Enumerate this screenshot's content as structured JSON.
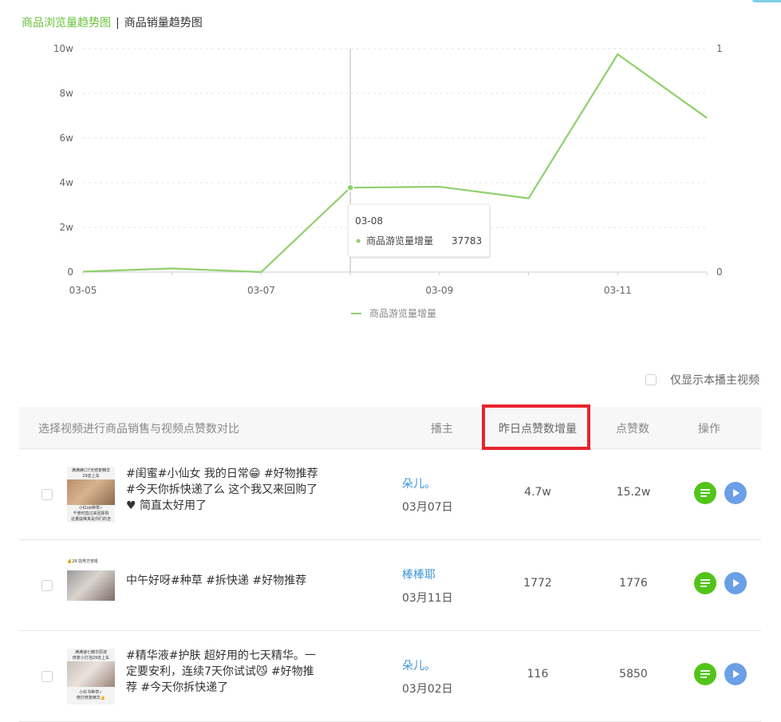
{
  "tabs": {
    "active": "商品浏览量趋势图",
    "separator": "|",
    "other": "商品销量趋势图"
  },
  "chart_data": {
    "type": "line",
    "x": [
      "03-05",
      "03-06",
      "03-07",
      "03-08",
      "03-09",
      "03-10",
      "03-11",
      "03-12"
    ],
    "x_tick_labels": [
      "03-05",
      "03-07",
      "03-09",
      "03-11"
    ],
    "y_tick_labels": [
      "0",
      "2w",
      "4w",
      "6w",
      "8w",
      "10w"
    ],
    "y2_tick_labels": [
      "0",
      "1"
    ],
    "series": [
      {
        "name": "商品游览量增量",
        "values": [
          200,
          1600,
          0,
          37783,
          38200,
          33000,
          97500,
          69000
        ],
        "color": "#8fd06c"
      }
    ],
    "ylim": [
      0,
      100000
    ],
    "y2lim": [
      0,
      1
    ],
    "grid": true,
    "legend_position": "bottom-center",
    "tooltip": {
      "date": "03-08",
      "label": "商品游览量增量",
      "value": "37783"
    }
  },
  "filter": {
    "only_this_label": "仅显示本播主视频"
  },
  "table": {
    "headers": {
      "select": "选择视频进行商品销售与视频点赞数对比",
      "author": "播主",
      "likes_increase": "昨日点赞数增量",
      "likes": "点赞数",
      "actions": "操作"
    },
    "rows": [
      {
        "thumb_caption": [
          "满满蜂口7天修复精华",
          "29去上车"
        ],
        "thumb_caption_bottom": [
          "小红ob种草✓",
          "千修时直过来回挥购",
          "这量提维真是你们的怎"
        ],
        "title": "#闺蜜#小仙女 我的日常😁 #好物推荐 #今天你拆快递了么 这个我又来回购了♥ 简直太好用了",
        "author": "朵儿。",
        "date": "03月07日",
        "likes_increase": "4.7w",
        "likes": "15.2w"
      },
      {
        "thumb_caption": [
          "💰29 前男方安吼"
        ],
        "thumb_caption_bottom": [],
        "title": "中午好呀#种草 #拆快递 #好物推荐",
        "author": "棒棒耶",
        "date": "03月11日",
        "likes_increase": "1772",
        "likes": "1776"
      },
      {
        "thumb_caption": [
          "满满速七精华原液",
          "修复小打泡29去上车"
        ],
        "thumb_caption_bottom": [
          "小红书种草✓",
          "修打修复精华👍"
        ],
        "title": "#精华液#护肤 超好用的七天精华。一定要安利，连续7天你试试😼 #好物推荐 #今天你拆快递了",
        "author": "朵儿。",
        "date": "03月02日",
        "likes_increase": "116",
        "likes": "5850"
      }
    ]
  }
}
